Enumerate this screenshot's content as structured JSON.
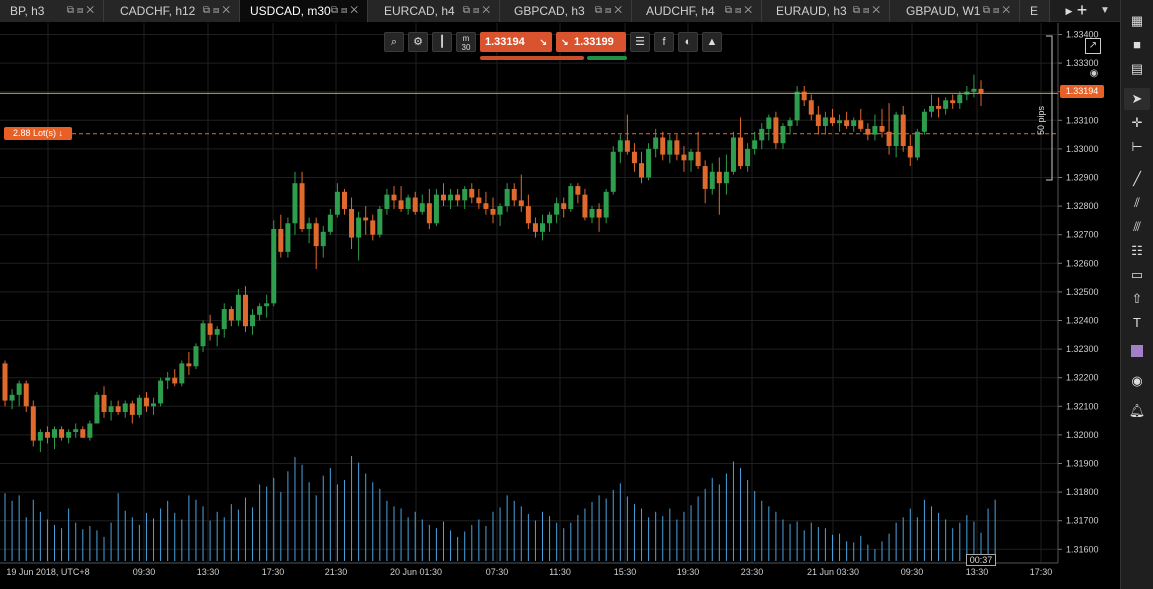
{
  "tabs": [
    {
      "label": "BP, h3",
      "active": false
    },
    {
      "label": "CADCHF, h12",
      "active": false
    },
    {
      "label": "USDCAD, m30",
      "active": true
    },
    {
      "label": "EURCAD, h4",
      "active": false
    },
    {
      "label": "GBPCAD, h3",
      "active": false
    },
    {
      "label": "AUDCHF, h4",
      "active": false
    },
    {
      "label": "EURAUD, h3",
      "active": false
    },
    {
      "label": "GBPAUD, W1",
      "active": false
    },
    {
      "label": "E",
      "active": false
    }
  ],
  "tab_controls": {
    "more": "▶",
    "add": "+",
    "chevron": "▼"
  },
  "chart_toolbar": {
    "icons": [
      "zoom-icon",
      "settings-icon",
      "candle-type-icon",
      "timeframe-icon",
      "orders-list-icon",
      "facebook-icon",
      "sentiment-icon",
      "hat-icon"
    ],
    "timeframe_top": "m",
    "timeframe_bottom": "30",
    "sell_price": "1.33194",
    "buy_price": "1.33199"
  },
  "labels": {
    "current_price": "1.33194",
    "lot_size": "2.88 Lot(s) ↓",
    "pips": "50 pips",
    "candle_timer": "00:37"
  },
  "colors": {
    "bull": "#2e9e4e",
    "bear": "#e06a2e",
    "volume": "#4aa3df",
    "price_line": "#c8a032",
    "order_line": "#e06a2e",
    "accent": "#e86026",
    "swatch": "#a37fc9"
  },
  "tools": [
    "grid-icon",
    "single-layout-icon",
    "split-layout-icon",
    "cursor-icon",
    "crosshair-icon",
    "measure-icon",
    "trendline-icon",
    "fib-icon",
    "channel-icon",
    "fib-levels-icon",
    "rectangle-icon",
    "shapes-icon",
    "text-icon",
    "color-swatch",
    "camera-icon",
    "alert-icon"
  ],
  "chart_data": {
    "type": "candlestick",
    "symbol": "USDCAD",
    "timeframe": "m30",
    "y_axis": {
      "ticks": [
        "1.33400",
        "1.33300",
        "1.33200",
        "1.33100",
        "1.33000",
        "1.32900",
        "1.32800",
        "1.32700",
        "1.32600",
        "1.32500",
        "1.32400",
        "1.32300",
        "1.32200",
        "1.32100",
        "1.32000",
        "1.31900",
        "1.31800",
        "1.31700",
        "1.31600"
      ]
    },
    "x_axis": {
      "ticks": [
        "19 Jun 2018, UTC+8",
        "09:30",
        "13:30",
        "17:30",
        "21:30",
        "20 Jun 01:30",
        "07:30",
        "11:30",
        "15:30",
        "19:30",
        "23:30",
        "21 Jun 03:30",
        "09:30",
        "13:30",
        "17:30"
      ]
    },
    "current_price": 1.33194,
    "order_price": 1.33053,
    "candles_ohlc": [
      [
        1.3225,
        1.3226,
        1.321,
        1.3212
      ],
      [
        1.3212,
        1.3216,
        1.3209,
        1.3214
      ],
      [
        1.3214,
        1.3219,
        1.321,
        1.3218
      ],
      [
        1.3218,
        1.3219,
        1.3208,
        1.321
      ],
      [
        1.321,
        1.3212,
        1.3196,
        1.3198
      ],
      [
        1.3198,
        1.3202,
        1.3194,
        1.3201
      ],
      [
        1.3201,
        1.3203,
        1.3197,
        1.3199
      ],
      [
        1.3199,
        1.3203,
        1.3195,
        1.3202
      ],
      [
        1.3202,
        1.3203,
        1.3198,
        1.3199
      ],
      [
        1.3199,
        1.3202,
        1.3197,
        1.3201
      ],
      [
        1.3201,
        1.3204,
        1.3199,
        1.3202
      ],
      [
        1.3202,
        1.3203,
        1.3199,
        1.3199
      ],
      [
        1.3199,
        1.3205,
        1.3198,
        1.3204
      ],
      [
        1.3204,
        1.3215,
        1.3204,
        1.3214
      ],
      [
        1.3214,
        1.3217,
        1.3206,
        1.3208
      ],
      [
        1.3208,
        1.3212,
        1.3205,
        1.321
      ],
      [
        1.321,
        1.3212,
        1.3207,
        1.3208
      ],
      [
        1.3208,
        1.3212,
        1.3206,
        1.3211
      ],
      [
        1.3211,
        1.3212,
        1.3204,
        1.3207
      ],
      [
        1.3207,
        1.3214,
        1.3206,
        1.3213
      ],
      [
        1.3213,
        1.3215,
        1.3208,
        1.321
      ],
      [
        1.321,
        1.3213,
        1.3207,
        1.3211
      ],
      [
        1.3211,
        1.322,
        1.321,
        1.3219
      ],
      [
        1.3219,
        1.3222,
        1.3216,
        1.322
      ],
      [
        1.322,
        1.3223,
        1.3217,
        1.3218
      ],
      [
        1.3218,
        1.3226,
        1.3217,
        1.3225
      ],
      [
        1.3225,
        1.3229,
        1.3221,
        1.3224
      ],
      [
        1.3224,
        1.3232,
        1.3223,
        1.3231
      ],
      [
        1.3231,
        1.324,
        1.3229,
        1.3239
      ],
      [
        1.3239,
        1.3242,
        1.3233,
        1.3235
      ],
      [
        1.3235,
        1.3238,
        1.3231,
        1.3237
      ],
      [
        1.3237,
        1.3246,
        1.3234,
        1.3244
      ],
      [
        1.3244,
        1.3245,
        1.3238,
        1.324
      ],
      [
        1.324,
        1.3251,
        1.3238,
        1.3249
      ],
      [
        1.3249,
        1.3252,
        1.3236,
        1.3238
      ],
      [
        1.3238,
        1.3244,
        1.3235,
        1.3242
      ],
      [
        1.3242,
        1.3246,
        1.324,
        1.3245
      ],
      [
        1.3245,
        1.3249,
        1.3241,
        1.3246
      ],
      [
        1.3246,
        1.3275,
        1.3245,
        1.3272
      ],
      [
        1.3272,
        1.3277,
        1.3262,
        1.3264
      ],
      [
        1.3264,
        1.3276,
        1.3262,
        1.3274
      ],
      [
        1.3274,
        1.3292,
        1.327,
        1.3288
      ],
      [
        1.3288,
        1.3292,
        1.3271,
        1.3272
      ],
      [
        1.3272,
        1.3276,
        1.3267,
        1.3274
      ],
      [
        1.3274,
        1.3276,
        1.3258,
        1.3266
      ],
      [
        1.3266,
        1.3273,
        1.3262,
        1.3271
      ],
      [
        1.3271,
        1.3279,
        1.327,
        1.3277
      ],
      [
        1.3277,
        1.3288,
        1.3276,
        1.3285
      ],
      [
        1.3285,
        1.3286,
        1.3277,
        1.3279
      ],
      [
        1.3279,
        1.3283,
        1.3265,
        1.3269
      ],
      [
        1.3269,
        1.3278,
        1.3261,
        1.3276
      ],
      [
        1.3276,
        1.328,
        1.327,
        1.3275
      ],
      [
        1.3275,
        1.3277,
        1.3268,
        1.327
      ],
      [
        1.327,
        1.328,
        1.3269,
        1.3279
      ],
      [
        1.3279,
        1.3286,
        1.3277,
        1.3284
      ],
      [
        1.3284,
        1.3287,
        1.3279,
        1.3282
      ],
      [
        1.3282,
        1.3287,
        1.3278,
        1.3279
      ],
      [
        1.3279,
        1.3284,
        1.3277,
        1.3283
      ],
      [
        1.3283,
        1.3285,
        1.3277,
        1.3278
      ],
      [
        1.3278,
        1.3284,
        1.3277,
        1.3281
      ],
      [
        1.3281,
        1.3286,
        1.3272,
        1.3274
      ],
      [
        1.3274,
        1.3286,
        1.3273,
        1.3284
      ],
      [
        1.3284,
        1.3288,
        1.328,
        1.3282
      ],
      [
        1.3282,
        1.3286,
        1.3279,
        1.3284
      ],
      [
        1.3284,
        1.3286,
        1.328,
        1.3282
      ],
      [
        1.3282,
        1.3287,
        1.3279,
        1.3286
      ],
      [
        1.3286,
        1.3288,
        1.3281,
        1.3283
      ],
      [
        1.3283,
        1.3286,
        1.3279,
        1.3281
      ],
      [
        1.3281,
        1.3285,
        1.3277,
        1.3279
      ],
      [
        1.3279,
        1.3283,
        1.3274,
        1.3277
      ],
      [
        1.3277,
        1.3281,
        1.3273,
        1.328
      ],
      [
        1.328,
        1.3288,
        1.3278,
        1.3286
      ],
      [
        1.3286,
        1.3288,
        1.328,
        1.3282
      ],
      [
        1.3282,
        1.3291,
        1.3278,
        1.328
      ],
      [
        1.328,
        1.3284,
        1.3272,
        1.3274
      ],
      [
        1.3274,
        1.3276,
        1.3269,
        1.3271
      ],
      [
        1.3271,
        1.3277,
        1.3268,
        1.3274
      ],
      [
        1.3274,
        1.3278,
        1.3271,
        1.3277
      ],
      [
        1.3277,
        1.3283,
        1.3274,
        1.3281
      ],
      [
        1.3281,
        1.3283,
        1.3276,
        1.3279
      ],
      [
        1.3279,
        1.3288,
        1.3278,
        1.3287
      ],
      [
        1.3287,
        1.3288,
        1.3281,
        1.3284
      ],
      [
        1.3284,
        1.3286,
        1.3275,
        1.3276
      ],
      [
        1.3276,
        1.328,
        1.3274,
        1.3279
      ],
      [
        1.3279,
        1.3281,
        1.3271,
        1.3276
      ],
      [
        1.3276,
        1.3286,
        1.3274,
        1.3285
      ],
      [
        1.3285,
        1.3301,
        1.3284,
        1.3299
      ],
      [
        1.3299,
        1.3305,
        1.3295,
        1.3303
      ],
      [
        1.3303,
        1.3312,
        1.3298,
        1.3299
      ],
      [
        1.3299,
        1.3302,
        1.3292,
        1.3295
      ],
      [
        1.3295,
        1.3299,
        1.3288,
        1.329
      ],
      [
        1.329,
        1.3302,
        1.3289,
        1.33
      ],
      [
        1.33,
        1.3307,
        1.3297,
        1.3304
      ],
      [
        1.3304,
        1.3306,
        1.3296,
        1.3298
      ],
      [
        1.3298,
        1.3305,
        1.3295,
        1.3303
      ],
      [
        1.3303,
        1.3305,
        1.3296,
        1.3298
      ],
      [
        1.3298,
        1.3301,
        1.3292,
        1.3296
      ],
      [
        1.3296,
        1.33,
        1.3292,
        1.3299
      ],
      [
        1.3299,
        1.3306,
        1.3293,
        1.3294
      ],
      [
        1.3294,
        1.3296,
        1.3281,
        1.3286
      ],
      [
        1.3286,
        1.3295,
        1.3284,
        1.3292
      ],
      [
        1.3292,
        1.3297,
        1.3277,
        1.3288
      ],
      [
        1.3288,
        1.3298,
        1.3284,
        1.3292
      ],
      [
        1.3292,
        1.3306,
        1.3291,
        1.3304
      ],
      [
        1.3304,
        1.3311,
        1.3293,
        1.3294
      ],
      [
        1.3294,
        1.3302,
        1.3292,
        1.33
      ],
      [
        1.33,
        1.3306,
        1.3298,
        1.3303
      ],
      [
        1.3303,
        1.3309,
        1.33,
        1.3307
      ],
      [
        1.3307,
        1.3312,
        1.3303,
        1.3311
      ],
      [
        1.3311,
        1.3313,
        1.33,
        1.3302
      ],
      [
        1.3302,
        1.3309,
        1.33,
        1.3308
      ],
      [
        1.3308,
        1.3311,
        1.3305,
        1.331
      ],
      [
        1.331,
        1.3322,
        1.3308,
        1.332
      ],
      [
        1.332,
        1.3322,
        1.3315,
        1.3317
      ],
      [
        1.3317,
        1.3319,
        1.331,
        1.3312
      ],
      [
        1.3312,
        1.3315,
        1.3305,
        1.3308
      ],
      [
        1.3308,
        1.3313,
        1.3305,
        1.3311
      ],
      [
        1.3311,
        1.3314,
        1.3308,
        1.3309
      ],
      [
        1.3309,
        1.3312,
        1.3306,
        1.331
      ],
      [
        1.331,
        1.3313,
        1.3307,
        1.3308
      ],
      [
        1.3308,
        1.3311,
        1.3306,
        1.331
      ],
      [
        1.331,
        1.3314,
        1.3306,
        1.3307
      ],
      [
        1.3307,
        1.3309,
        1.3303,
        1.3305
      ],
      [
        1.3305,
        1.3312,
        1.3303,
        1.3308
      ],
      [
        1.3308,
        1.3314,
        1.3304,
        1.3306
      ],
      [
        1.3306,
        1.3316,
        1.3298,
        1.3301
      ],
      [
        1.3301,
        1.3313,
        1.3297,
        1.3312
      ],
      [
        1.3312,
        1.3315,
        1.3299,
        1.3301
      ],
      [
        1.3301,
        1.3305,
        1.3294,
        1.3297
      ],
      [
        1.3297,
        1.3307,
        1.3296,
        1.3306
      ],
      [
        1.3306,
        1.3314,
        1.3305,
        1.3313
      ],
      [
        1.3313,
        1.3319,
        1.3311,
        1.3315
      ],
      [
        1.3315,
        1.3318,
        1.3311,
        1.3314
      ],
      [
        1.3314,
        1.3318,
        1.3312,
        1.3317
      ],
      [
        1.3317,
        1.3319,
        1.3314,
        1.3316
      ],
      [
        1.3316,
        1.332,
        1.3314,
        1.3319
      ],
      [
        1.3319,
        1.3322,
        1.3317,
        1.332
      ],
      [
        1.332,
        1.3326,
        1.3318,
        1.3321
      ],
      [
        1.3321,
        1.3324,
        1.3315,
        1.33194
      ]
    ],
    "volume": [
      62,
      55,
      60,
      40,
      56,
      45,
      38,
      33,
      30,
      48,
      35,
      29,
      32,
      28,
      22,
      35,
      62,
      46,
      40,
      33,
      44,
      39,
      48,
      55,
      44,
      38,
      60,
      56,
      50,
      37,
      45,
      40,
      52,
      47,
      58,
      49,
      70,
      68,
      76,
      63,
      82,
      95,
      88,
      72,
      60,
      78,
      85,
      70,
      74,
      96,
      90,
      80,
      72,
      66,
      55,
      50,
      48,
      40,
      45,
      38,
      33,
      30,
      36,
      28,
      22,
      27,
      33,
      38,
      32,
      45,
      49,
      60,
      55,
      50,
      43,
      37,
      45,
      41,
      35,
      30,
      35,
      42,
      48,
      54,
      60,
      57,
      65,
      71,
      59,
      52,
      48,
      40,
      45,
      41,
      48,
      38,
      45,
      51,
      59,
      66,
      76,
      70,
      80,
      91,
      85,
      74,
      64,
      55,
      50,
      45,
      38,
      34,
      36,
      28,
      35,
      31,
      30,
      24,
      25,
      18,
      17,
      23,
      15,
      11,
      18,
      25,
      35,
      40,
      48,
      40,
      56,
      50,
      44,
      38,
      30,
      35,
      42,
      36,
      26,
      48,
      56
    ]
  }
}
